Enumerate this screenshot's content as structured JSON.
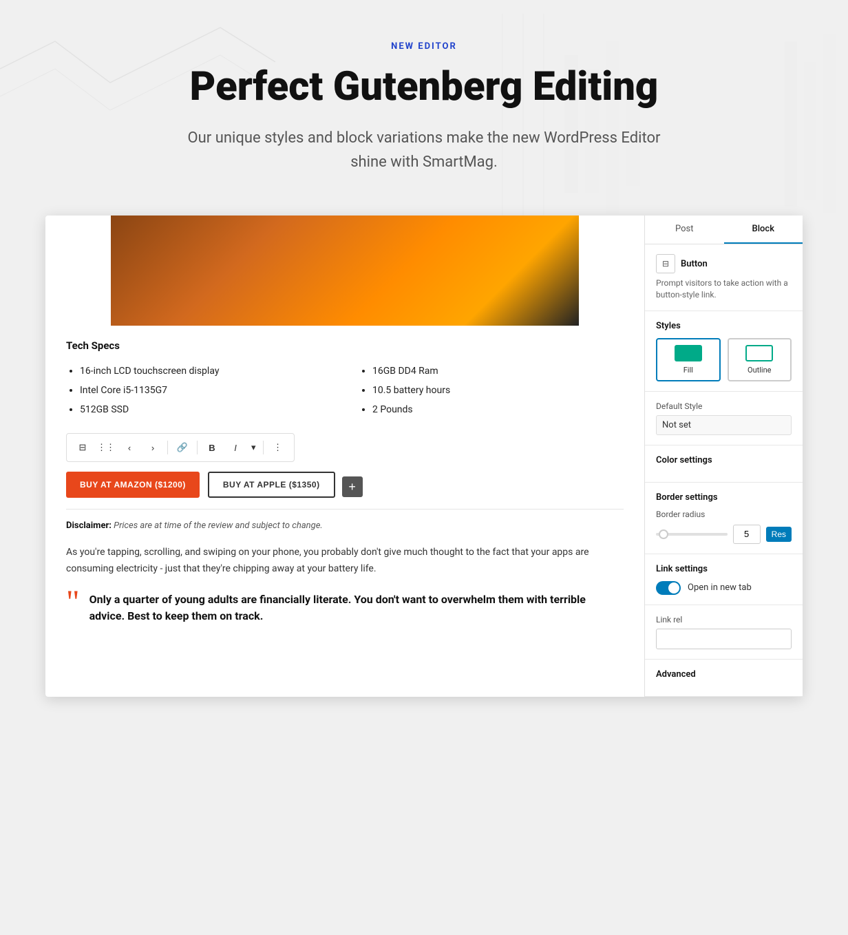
{
  "hero": {
    "label": "NEW EDITOR",
    "title": "Perfect Gutenberg Editing",
    "subtitle": "Our unique styles and block variations make the new WordPress Editor shine with SmartMag."
  },
  "editor": {
    "tabs": {
      "post": "Post",
      "block": "Block"
    },
    "block": {
      "name": "Button",
      "description": "Prompt visitors to take action with a button-style link."
    },
    "styles_label": "Styles",
    "style_fill": "Fill",
    "style_outline": "Outline",
    "default_style_label": "Default Style",
    "default_style_value": "Not set",
    "color_settings_label": "Color settings",
    "border_settings_label": "Border settings",
    "border_radius_label": "Border radius",
    "border_radius_value": "5",
    "border_reset_label": "Res",
    "link_settings_label": "Link settings",
    "open_new_tab_label": "Open in new tab",
    "link_rel_label": "Link rel",
    "advanced_label": "Advanced"
  },
  "article": {
    "tech_specs_title": "Tech Specs",
    "specs_left": [
      "16-inch LCD touchscreen display",
      "Intel Core i5-1135G7",
      "512GB SSD"
    ],
    "specs_right": [
      "16GB DD4 Ram",
      "10.5 battery hours",
      "2 Pounds"
    ],
    "btn_amazon_label": "BUY AT AMAZON ($1200)",
    "btn_apple_label": "BUY AT APPLE ($1350)",
    "disclaimer": "Disclaimer:",
    "disclaimer_text": "Prices are at time of the review and subject to change.",
    "body_text": "As you're tapping, scrolling, and swiping on your phone, you probably don't give much thought to the fact that your apps are consuming electricity - just that they're chipping away at your battery life.",
    "quote_text": "Only a quarter of young adults are financially literate. You don't want to overwhelm them with terrible advice. Best to keep them on track."
  },
  "toolbar": {
    "icon_layout": "⊟",
    "icon_grid": "⋮⋮",
    "icon_left": "‹",
    "icon_right": "›",
    "icon_link": "🔗",
    "icon_bold": "B",
    "icon_italic": "I",
    "icon_more": "⋮"
  },
  "colors": {
    "accent_blue": "#2244cc",
    "accent_orange": "#e8471b",
    "accent_teal": "#00aa88",
    "link_blue": "#007cba"
  }
}
